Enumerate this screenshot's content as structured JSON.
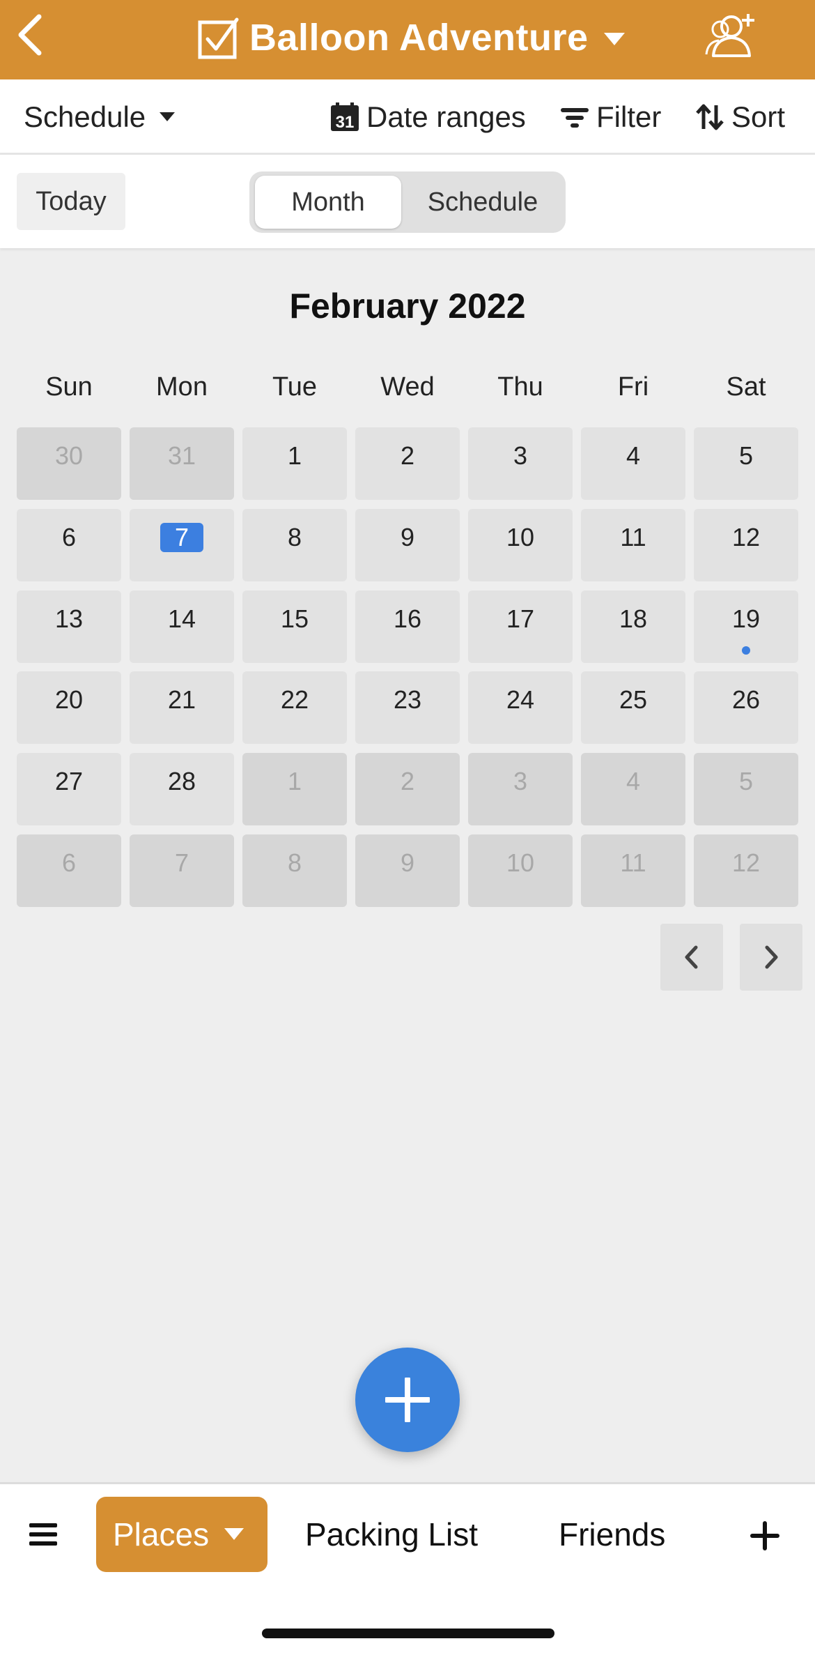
{
  "header": {
    "title": "Balloon Adventure",
    "background_color": "#d68f32",
    "icons": [
      "back-icon",
      "checkbox-icon",
      "caret-down-icon",
      "add-friend-icon"
    ]
  },
  "toolbar": {
    "view_label": "Schedule",
    "date_ranges_label": "Date ranges",
    "date_ranges_icon_number": "31",
    "filter_label": "Filter",
    "sort_label": "Sort"
  },
  "controls": {
    "today_label": "Today",
    "segments": [
      {
        "label": "Month",
        "selected": true
      },
      {
        "label": "Schedule",
        "selected": false
      }
    ]
  },
  "calendar": {
    "month_title": "February 2022",
    "weekdays": [
      "Sun",
      "Mon",
      "Tue",
      "Wed",
      "Thu",
      "Fri",
      "Sat"
    ],
    "weeks": [
      [
        {
          "day": "30",
          "current": false
        },
        {
          "day": "31",
          "current": false
        },
        {
          "day": "1",
          "current": true
        },
        {
          "day": "2",
          "current": true
        },
        {
          "day": "3",
          "current": true
        },
        {
          "day": "4",
          "current": true
        },
        {
          "day": "5",
          "current": true
        }
      ],
      [
        {
          "day": "6",
          "current": true
        },
        {
          "day": "7",
          "current": true,
          "today": true
        },
        {
          "day": "8",
          "current": true
        },
        {
          "day": "9",
          "current": true
        },
        {
          "day": "10",
          "current": true
        },
        {
          "day": "11",
          "current": true
        },
        {
          "day": "12",
          "current": true
        }
      ],
      [
        {
          "day": "13",
          "current": true
        },
        {
          "day": "14",
          "current": true
        },
        {
          "day": "15",
          "current": true
        },
        {
          "day": "16",
          "current": true
        },
        {
          "day": "17",
          "current": true
        },
        {
          "day": "18",
          "current": true
        },
        {
          "day": "19",
          "current": true,
          "has_event": true
        }
      ],
      [
        {
          "day": "20",
          "current": true
        },
        {
          "day": "21",
          "current": true
        },
        {
          "day": "22",
          "current": true
        },
        {
          "day": "23",
          "current": true
        },
        {
          "day": "24",
          "current": true
        },
        {
          "day": "25",
          "current": true
        },
        {
          "day": "26",
          "current": true
        }
      ],
      [
        {
          "day": "27",
          "current": true
        },
        {
          "day": "28",
          "current": true
        },
        {
          "day": "1",
          "current": false
        },
        {
          "day": "2",
          "current": false
        },
        {
          "day": "3",
          "current": false
        },
        {
          "day": "4",
          "current": false
        },
        {
          "day": "5",
          "current": false
        }
      ],
      [
        {
          "day": "6",
          "current": false
        },
        {
          "day": "7",
          "current": false
        },
        {
          "day": "8",
          "current": false
        },
        {
          "day": "9",
          "current": false
        },
        {
          "day": "10",
          "current": false
        },
        {
          "day": "11",
          "current": false
        },
        {
          "day": "12",
          "current": false
        }
      ]
    ],
    "today_color": "#3c7fe0",
    "event_dot_color": "#3c7fe0"
  },
  "fab": {
    "icon": "plus-icon",
    "color": "#3a82dc"
  },
  "bottom_tabs": {
    "active_label": "Places",
    "packing_label": "Packing List",
    "friends_label": "Friends",
    "active_color": "#d68f32"
  }
}
